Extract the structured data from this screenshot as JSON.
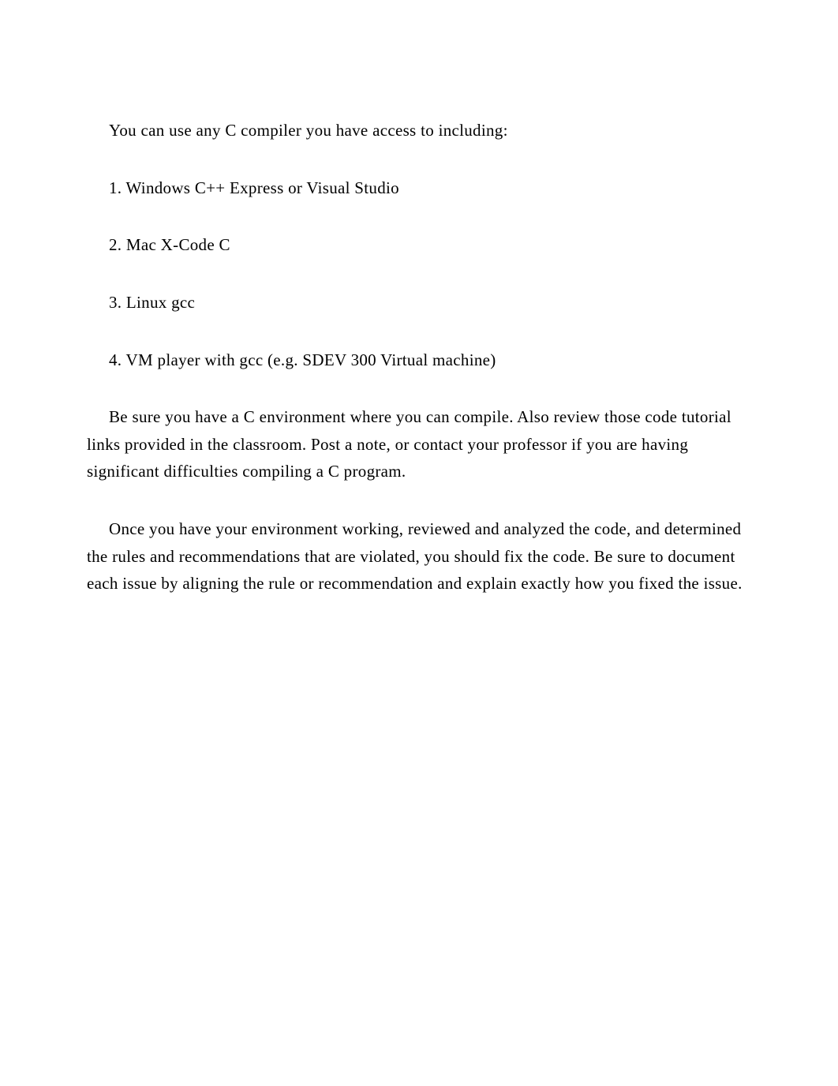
{
  "intro": "You can use any C compiler you have access to including:",
  "list": {
    "items": [
      {
        "marker": "1.",
        "text": "Windows C++ Express or Visual Studio"
      },
      {
        "marker": "2.",
        "text": "Mac X-Code C"
      },
      {
        "marker": "3.",
        "text": "Linux gcc"
      },
      {
        "marker": "4.",
        "text": "VM player with gcc (e.g. SDEV 300 Virtual machine)"
      }
    ]
  },
  "paragraphs": [
    "Be sure you have a C environment where you can compile. Also review those code tutorial links provided in the classroom. Post a note, or contact your professor if you are having significant difficulties compiling a C program.",
    "Once you have your environment working, reviewed and analyzed the code, and determined the rules and recommendations that are violated, you should fix the code. Be sure to document each issue by aligning the rule or recommendation and explain exactly how you fixed the issue."
  ]
}
